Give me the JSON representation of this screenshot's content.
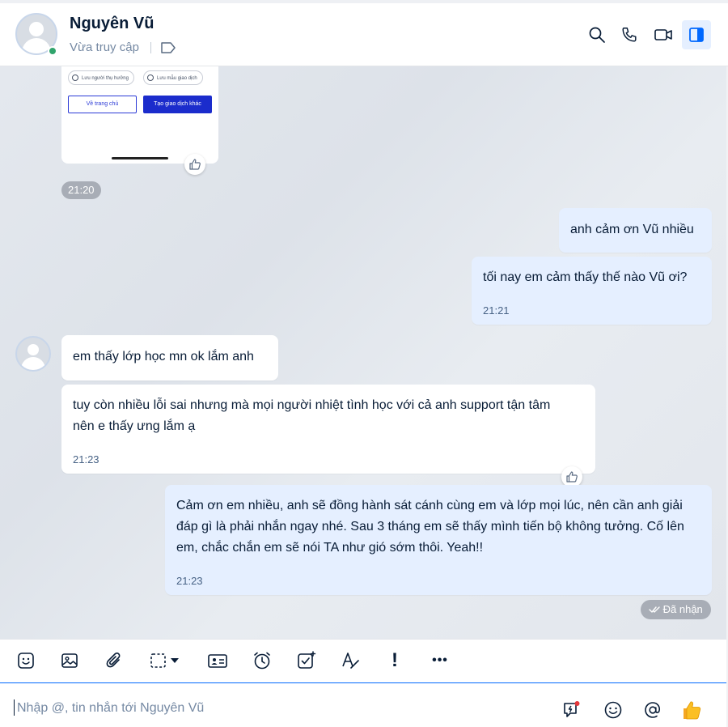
{
  "header": {
    "name": "Nguyên Vũ",
    "status": "Vừa truy cập"
  },
  "preview_card": {
    "chip_save_payee": "Lưu người thụ hưởng",
    "chip_save_template": "Lưu mẫu giao dịch",
    "btn_home": "Về trang chủ",
    "btn_new": "Tạo giao dịch khác"
  },
  "messages": {
    "time_card": "21:20",
    "out1": "anh cảm ơn Vũ nhiều",
    "out2": "tối nay em cảm thấy thế nào Vũ ơi?",
    "out2_time": "21:21",
    "in1": "em thấy lớp học mn ok lắm anh",
    "in2": "tuy còn nhiều lỗi sai nhưng mà mọi người nhiệt tình học với cả anh support tận tâm nên e thấy ưng lắm ạ",
    "in2_time": "21:23",
    "out3": "Cảm ơn em nhiều, anh sẽ đồng hành sát cánh cùng em và lớp mọi lúc, nên cần anh giải đáp gì là phải nhắn ngay nhé. Sau 3 tháng em sẽ thấy mình tiến bộ không tưởng. Cố lên em, chắc chắn em sẽ nói TA như gió sớm thôi. Yeah!!",
    "out3_time": "21:23",
    "received": "Đã nhận"
  },
  "toolbar": {
    "urgent": "!",
    "more": "•••"
  },
  "composer": {
    "placeholder": "Nhập @, tin nhắn tới Nguyên Vũ"
  },
  "colors": {
    "accent": "#0068ff",
    "out_bubble": "#e5efff",
    "online": "#30a46c"
  }
}
